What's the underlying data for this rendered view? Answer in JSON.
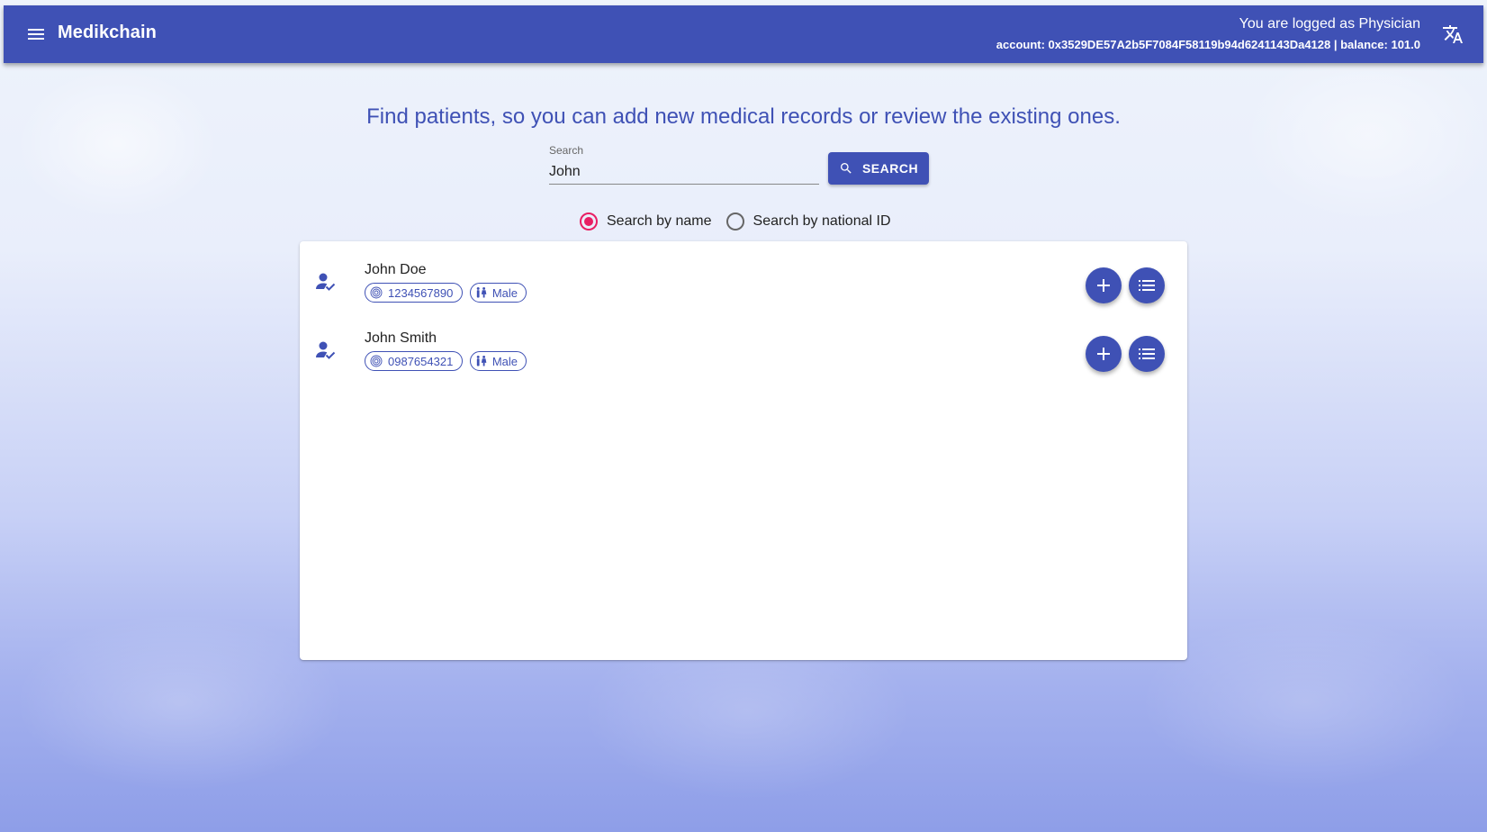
{
  "colors": {
    "primary": "#3f51b5",
    "accent": "#e91e63"
  },
  "appbar": {
    "menu_icon": "menu-icon",
    "title": "Medikchain",
    "user_role": "You are logged as Physician",
    "account_line": "account: 0x3529DE57A2b5F7084F58119b94d6241143Da4128 | balance: 101.0",
    "translate_icon": "translate-icon"
  },
  "headline": "Find patients, so you can add new medical records or review the existing ones.",
  "search": {
    "label": "Search",
    "value": "John",
    "button_label": "SEARCH",
    "button_icon": "search-icon"
  },
  "search_mode": {
    "options": [
      {
        "label": "Search by name",
        "checked": true
      },
      {
        "label": "Search by national ID",
        "checked": false
      }
    ]
  },
  "patients": [
    {
      "name": "John Doe",
      "national_id": "1234567890",
      "gender": "Male"
    },
    {
      "name": "John Smith",
      "national_id": "0987654321",
      "gender": "Male"
    }
  ]
}
